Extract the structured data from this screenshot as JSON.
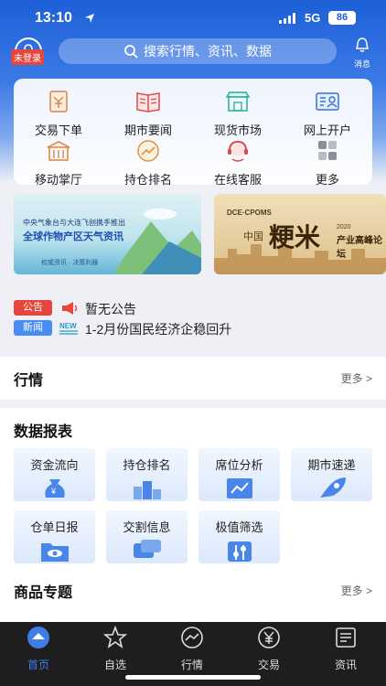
{
  "status": {
    "time": "13:10",
    "network": "5G",
    "battery": "86"
  },
  "header": {
    "login_badge": "未登录",
    "search_placeholder": "搜索行情、资讯、数据",
    "bell_label": "消息"
  },
  "quick_grid": [
    {
      "label": "交易下单",
      "icon": "trade-order-icon"
    },
    {
      "label": "期市要闻",
      "icon": "news-book-icon"
    },
    {
      "label": "现货市场",
      "icon": "market-stall-icon"
    },
    {
      "label": "网上开户",
      "icon": "account-card-icon"
    },
    {
      "label": "移动掌厅",
      "icon": "mobile-hall-icon"
    },
    {
      "label": "持仓排名",
      "icon": "position-rank-icon"
    },
    {
      "label": "在线客服",
      "icon": "customer-service-icon"
    },
    {
      "label": "更多",
      "icon": "more-grid-icon"
    }
  ],
  "banners": {
    "b1": {
      "sub": "中央气象台与大连飞创携手推出",
      "title": "全球作物产区天气资讯",
      "tags": "权威资讯 · 决策利器"
    },
    "b2": {
      "top": "DCE·CPOMS",
      "china": "中国",
      "big": "粳米",
      "year": "2020",
      "forum": "产业高峰论坛"
    }
  },
  "notices": [
    {
      "tag": "公告",
      "text": "暂无公告"
    },
    {
      "tag": "新闻",
      "text": "1-2月份国民经济企稳回升"
    }
  ],
  "market": {
    "title": "行情",
    "more": "更多 >"
  },
  "reports": {
    "title": "数据报表",
    "items": [
      "资金流向",
      "持仓排名",
      "席位分析",
      "期市速递",
      "仓单日报",
      "交割信息",
      "极值筛选"
    ]
  },
  "products": {
    "title": "商品专题",
    "more": "更多 >"
  },
  "nav": [
    "首页",
    "自选",
    "行情",
    "交易",
    "资讯"
  ],
  "colors": {
    "primary": "#1d5fd8",
    "accent": "#e8453c",
    "nav_bg": "#1e1e20"
  }
}
